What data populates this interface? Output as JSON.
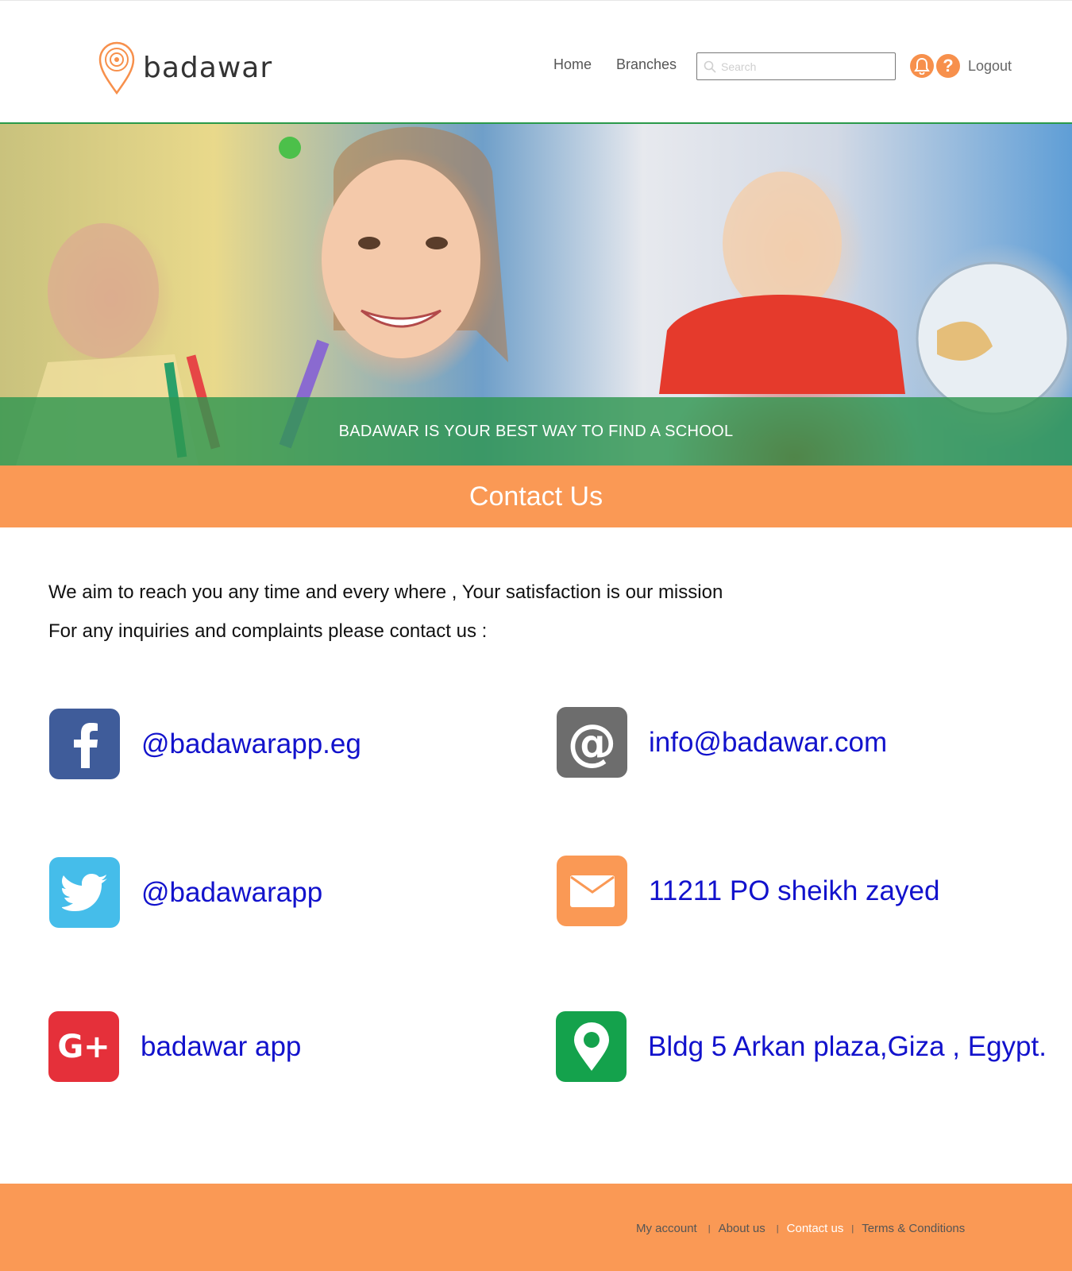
{
  "header": {
    "logo_text": "badawar",
    "nav": {
      "home": "Home",
      "branches": "Branches"
    },
    "search_placeholder": "Search",
    "logout": "Logout",
    "accent_color": "#f7904c"
  },
  "hero": {
    "banner_text": "BADAWAR IS YOUR BEST WAY TO FIND A SCHOOL"
  },
  "page_title": "Contact Us",
  "intro": {
    "line1": "We aim to reach you any time and every where , Your satisfaction is our mission",
    "line2": "For any inquiries and complaints please contact us :"
  },
  "contacts": {
    "facebook": "@badawarapp.eg",
    "email": "info@badawar.com",
    "twitter": "@badawarapp",
    "mail": "11211 PO sheikh zayed",
    "googleplus": "badawar app",
    "address": "Bldg 5 Arkan plaza,Giza , Egypt."
  },
  "footer": {
    "links": [
      "My account",
      "About us",
      "Contact us",
      "Terms & Conditions"
    ],
    "separator": "|"
  }
}
